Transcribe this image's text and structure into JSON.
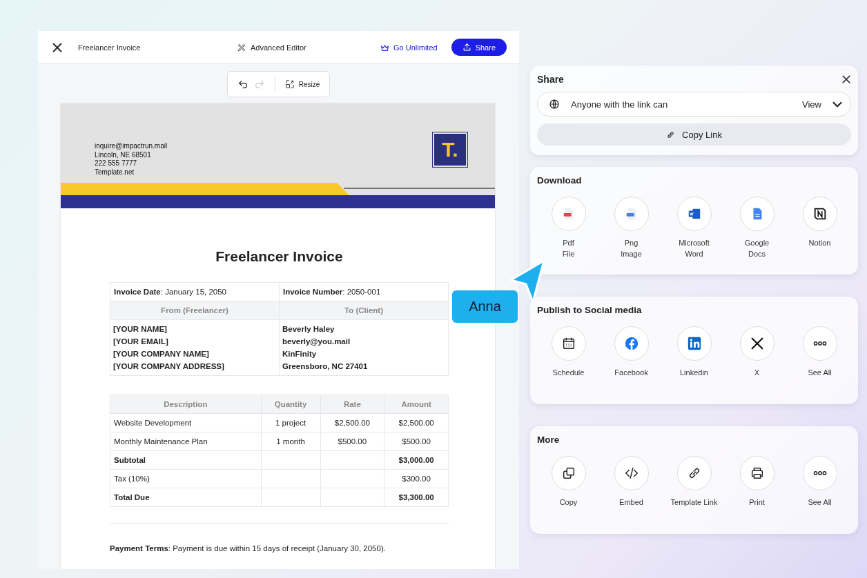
{
  "editor": {
    "title": "Freelancer Invoice",
    "mode_label": "Advanced Editor",
    "upgrade_link": "Go Unlimited",
    "share_button": "Share",
    "toolbar": {
      "undo": {
        "disabled": false
      },
      "redo": {
        "disabled": true
      },
      "resize_button": "Resize"
    }
  },
  "document": {
    "contact_lines": [
      "inquire@impactrun.mail",
      "Lincoln, NE 68501",
      "222 555 7777",
      "Template.net"
    ],
    "logo_text": "T.",
    "heading": "Freelancer Invoice",
    "info_table": {
      "top": [
        "**Invoice Date**: January 15, 2050",
        "**Invoice Number**: 2050-001"
      ],
      "columns": [
        "From (Freelancer)",
        "To (Client)"
      ],
      "rows": [
        [
          "[YOUR NAME]",
          "Beverly Haley"
        ],
        [
          "[YOUR EMAIL]",
          "beverly@you.mail"
        ],
        [
          "[YOUR COMPANY NAME]",
          "KinFinity"
        ],
        [
          "[YOUR COMPANY ADDRESS]",
          "Greensboro, NC 27401"
        ]
      ]
    },
    "items_table": {
      "columns": [
        "Description",
        "Quantity",
        "Rate",
        "Amount"
      ],
      "rows": [
        {
          "cells": [
            "Website Development",
            "1 project",
            "$2,500.00",
            "$2,500.00"
          ],
          "emphasis": false
        },
        {
          "cells": [
            "Monthly Maintenance Plan",
            "1 month",
            "$500.00",
            "$500.00"
          ],
          "emphasis": false
        },
        {
          "cells": [
            "Subtotal",
            "",
            "",
            "$3,000.00"
          ],
          "emphasis": true
        },
        {
          "cells": [
            "Tax (10%)",
            "",
            "",
            "$300.00"
          ],
          "emphasis": false
        },
        {
          "cells": [
            "Total Due",
            "",
            "",
            "$3,300.00"
          ],
          "emphasis": true
        }
      ]
    },
    "payment_terms": "**Payment Terms**: Payment is due within 15 days of receipt (January 30, 2050)."
  },
  "share_panel": {
    "title": "Share",
    "access": {
      "text": "Anyone with the link can",
      "permission": "View"
    },
    "copy_button": "Copy Link"
  },
  "sections": [
    {
      "title": "Download",
      "items": [
        {
          "label": "Pdf\nFile"
        },
        {
          "label": "Png\nImage"
        },
        {
          "label": "Microsoft\nWord"
        },
        {
          "label": "Google\nDocs"
        },
        {
          "label": "Notion"
        }
      ]
    },
    {
      "title": "Publish to Social media",
      "items": [
        {
          "label": "Schedule"
        },
        {
          "label": "Facebook"
        },
        {
          "label": "Linkedin"
        },
        {
          "label": "X"
        },
        {
          "label": "See All"
        }
      ]
    },
    {
      "title": "More",
      "items": [
        {
          "label": "Copy"
        },
        {
          "label": "Embed"
        },
        {
          "label": "Template Link"
        },
        {
          "label": "Print"
        },
        {
          "label": "See All"
        }
      ]
    }
  ],
  "cursor": {
    "name": "Anna",
    "color": "#1eb0ee"
  }
}
